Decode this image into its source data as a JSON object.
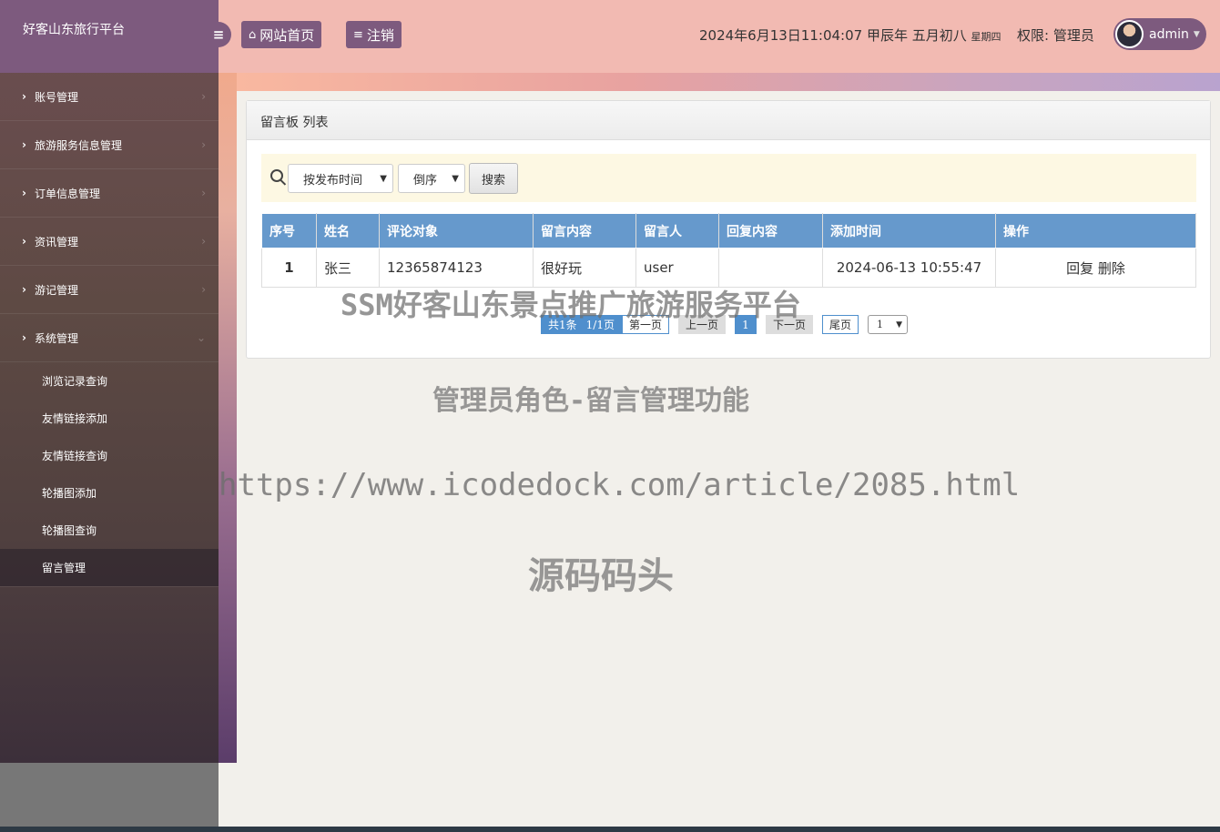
{
  "app": {
    "brand": "好客山东旅行平台"
  },
  "header": {
    "home_label": "网站首页",
    "logout_label": "注销",
    "datetime": "2024年6月13日11:04:07 甲辰年 五月初八",
    "weekday": "星期四",
    "permission": "权限: 管理员",
    "username": "admin"
  },
  "sidebar": {
    "items": [
      {
        "label": "账号管理"
      },
      {
        "label": "旅游服务信息管理"
      },
      {
        "label": "订单信息管理"
      },
      {
        "label": "资讯管理"
      },
      {
        "label": "游记管理"
      },
      {
        "label": "系统管理"
      }
    ],
    "sub_items": [
      {
        "label": "浏览记录查询"
      },
      {
        "label": "友情链接添加"
      },
      {
        "label": "友情链接查询"
      },
      {
        "label": "轮播图添加"
      },
      {
        "label": "轮播图查询"
      },
      {
        "label": "留言管理"
      }
    ]
  },
  "panel": {
    "title": "留言板 列表",
    "sort_field": "按发布时间",
    "sort_order": "倒序",
    "search_label": "搜索"
  },
  "table": {
    "headers": [
      "序号",
      "姓名",
      "评论对象",
      "留言内容",
      "留言人",
      "回复内容",
      "添加时间",
      "操作"
    ],
    "rows": [
      {
        "idx": "1",
        "name": "张三",
        "target": "12365874123",
        "content": "很好玩",
        "author": "user",
        "reply": "",
        "time": "2024-06-13 10:55:47",
        "op_reply": "回复",
        "op_delete": "删除"
      }
    ]
  },
  "pager": {
    "total": "共1条",
    "pages": "1/1页",
    "first": "第一页",
    "prev": "上一页",
    "current": "1",
    "next": "下一页",
    "last": "尾页",
    "select_value": "1"
  },
  "watermarks": {
    "line1": "SSM好客山东景点推广旅游服务平台",
    "line2": "管理员角色-留言管理功能",
    "line3": "https://www.icodedock.com/article/2085.html",
    "line4": "源码码头"
  }
}
